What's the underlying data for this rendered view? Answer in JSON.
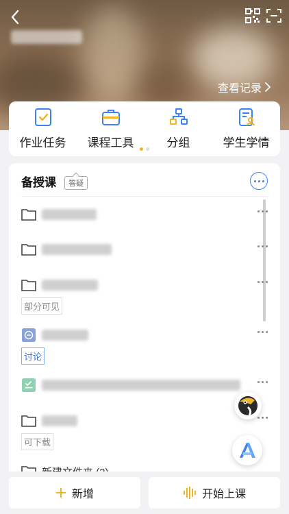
{
  "header": {
    "history_label": "查看记录",
    "back_icon": "chevron-left-icon",
    "qr_icon": "qr-code-icon",
    "scan_icon": "scan-icon"
  },
  "tools": [
    {
      "label": "作业任务",
      "icon": "task-check-icon"
    },
    {
      "label": "课程工具",
      "icon": "toolbox-icon"
    },
    {
      "label": "分组",
      "icon": "group-tree-icon"
    },
    {
      "label": "学生学情",
      "icon": "student-report-icon"
    }
  ],
  "card": {
    "title": "备授课",
    "qa_tag": "答疑",
    "badges": {
      "partial": "部分可见",
      "discussion": "讨论",
      "downloadable": "可下载"
    },
    "last_item": "新建文件夹 (2)"
  },
  "bottom": {
    "add_label": "新增",
    "start_label": "开始上课"
  },
  "colors": {
    "accent_blue": "#3b82f6",
    "accent_yellow": "#f0b429",
    "page_bg": "#f2f2f4"
  }
}
